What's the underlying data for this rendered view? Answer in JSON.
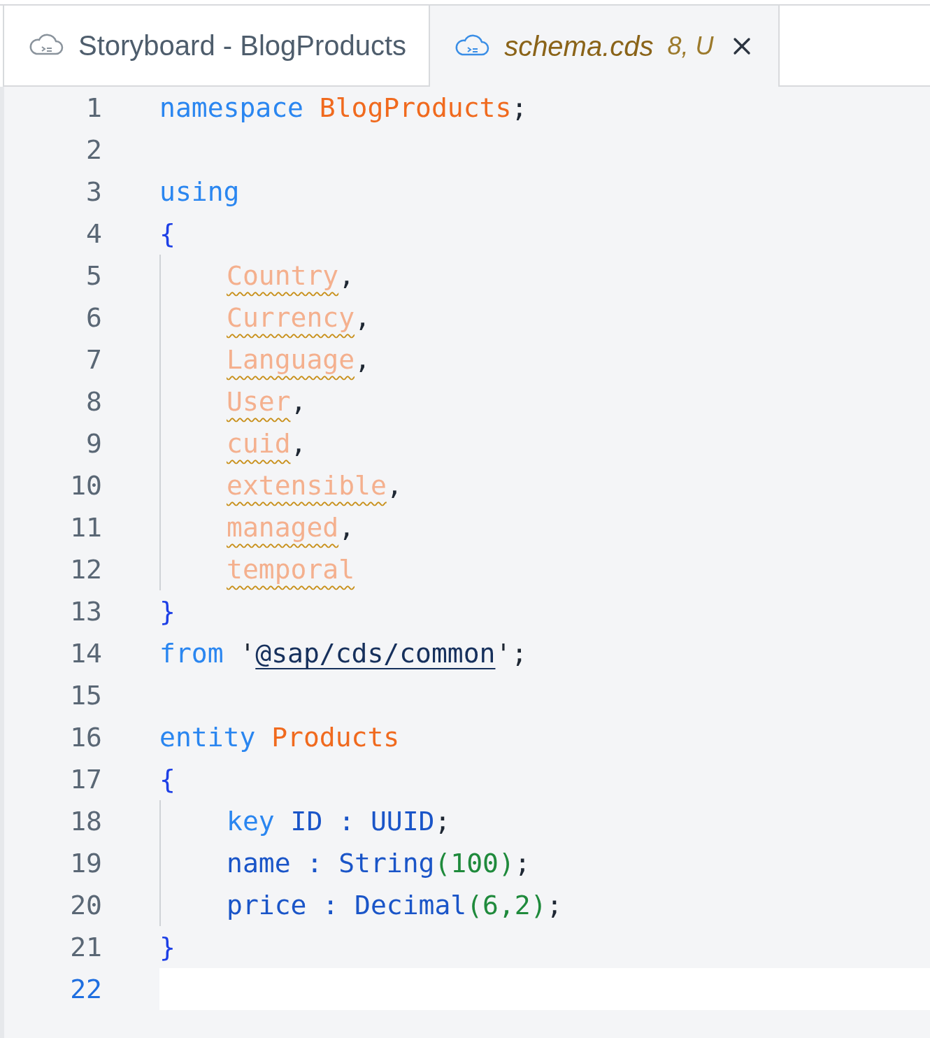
{
  "tabs": [
    {
      "label": "Storyboard - BlogProducts",
      "selected": false,
      "closable": false
    },
    {
      "label": "schema.cds",
      "detail": "8, U",
      "selected": true,
      "closable": true
    }
  ],
  "editor": {
    "lines": [
      {
        "number": "1",
        "current": false,
        "indented": false,
        "tokens": [
          {
            "text": "namespace",
            "kind": "keyword"
          },
          {
            "text": " BlogProducts",
            "kind": "name"
          },
          {
            "text": ";",
            "kind": "punct"
          }
        ]
      },
      {
        "number": "2",
        "current": false,
        "indented": false
      },
      {
        "number": "3",
        "current": false,
        "indented": false,
        "tokens": [
          {
            "text": "using",
            "kind": "keyword"
          }
        ]
      },
      {
        "number": "4",
        "current": false,
        "indented": false,
        "tokens": [
          {
            "text": "{",
            "kind": "brace"
          }
        ]
      },
      {
        "number": "5",
        "current": false,
        "indented": true,
        "tokens": [
          {
            "text": "Country",
            "kind": "warning"
          },
          {
            "text": ",",
            "kind": "punct"
          }
        ]
      },
      {
        "number": "6",
        "current": false,
        "indented": true,
        "tokens": [
          {
            "text": "Currency",
            "kind": "warning"
          },
          {
            "text": ",",
            "kind": "punct"
          }
        ]
      },
      {
        "number": "7",
        "current": false,
        "indented": true,
        "tokens": [
          {
            "text": "Language",
            "kind": "warning"
          },
          {
            "text": ",",
            "kind": "punct"
          }
        ]
      },
      {
        "number": "8",
        "current": false,
        "indented": true,
        "tokens": [
          {
            "text": "User",
            "kind": "warning"
          },
          {
            "text": ",",
            "kind": "punct"
          }
        ]
      },
      {
        "number": "9",
        "current": false,
        "indented": true,
        "tokens": [
          {
            "text": "cuid",
            "kind": "warning"
          },
          {
            "text": ",",
            "kind": "punct"
          }
        ]
      },
      {
        "number": "10",
        "current": false,
        "indented": true,
        "tokens": [
          {
            "text": "extensible",
            "kind": "warning"
          },
          {
            "text": ",",
            "kind": "punct"
          }
        ]
      },
      {
        "number": "11",
        "current": false,
        "indented": true,
        "tokens": [
          {
            "text": "managed",
            "kind": "warning"
          },
          {
            "text": ",",
            "kind": "punct"
          }
        ]
      },
      {
        "number": "12",
        "current": false,
        "indented": true,
        "tokens": [
          {
            "text": "temporal",
            "kind": "warning"
          }
        ]
      },
      {
        "number": "13",
        "current": false,
        "indented": false,
        "tokens": [
          {
            "text": "}",
            "kind": "brace"
          }
        ]
      },
      {
        "number": "14",
        "current": false,
        "indented": false,
        "tokens": [
          {
            "text": "from",
            "kind": "keyword"
          },
          {
            "text": " '",
            "kind": "punct"
          },
          {
            "text": "@sap/cds/common",
            "kind": "link"
          },
          {
            "text": "';",
            "kind": "punct"
          }
        ]
      },
      {
        "number": "15",
        "current": false,
        "indented": false
      },
      {
        "number": "16",
        "current": false,
        "indented": false,
        "tokens": [
          {
            "text": "entity",
            "kind": "keyword"
          },
          {
            "text": " Products",
            "kind": "name"
          }
        ]
      },
      {
        "number": "17",
        "current": false,
        "indented": false,
        "tokens": [
          {
            "text": "{",
            "kind": "brace"
          }
        ]
      },
      {
        "number": "18",
        "current": false,
        "indented": true,
        "tokens": [
          {
            "text": "key",
            "kind": "keyword"
          },
          {
            "text": " ID : UUID",
            "kind": "type"
          },
          {
            "text": ";",
            "kind": "punct"
          }
        ]
      },
      {
        "number": "19",
        "current": false,
        "indented": true,
        "tokens": [
          {
            "text": "name : String",
            "kind": "type"
          },
          {
            "text": "(",
            "kind": "paren"
          },
          {
            "text": "100",
            "kind": "number"
          },
          {
            "text": ")",
            "kind": "paren"
          },
          {
            "text": ";",
            "kind": "punct"
          }
        ]
      },
      {
        "number": "20",
        "current": false,
        "indented": true,
        "tokens": [
          {
            "text": "price : Decimal",
            "kind": "type"
          },
          {
            "text": "(",
            "kind": "paren"
          },
          {
            "text": "6,2",
            "kind": "number"
          },
          {
            "text": ")",
            "kind": "paren"
          },
          {
            "text": ";",
            "kind": "punct"
          }
        ]
      },
      {
        "number": "21",
        "current": false,
        "indented": false,
        "tokens": [
          {
            "text": "}",
            "kind": "brace"
          }
        ]
      },
      {
        "number": "22",
        "current": true,
        "indented": false
      }
    ]
  }
}
